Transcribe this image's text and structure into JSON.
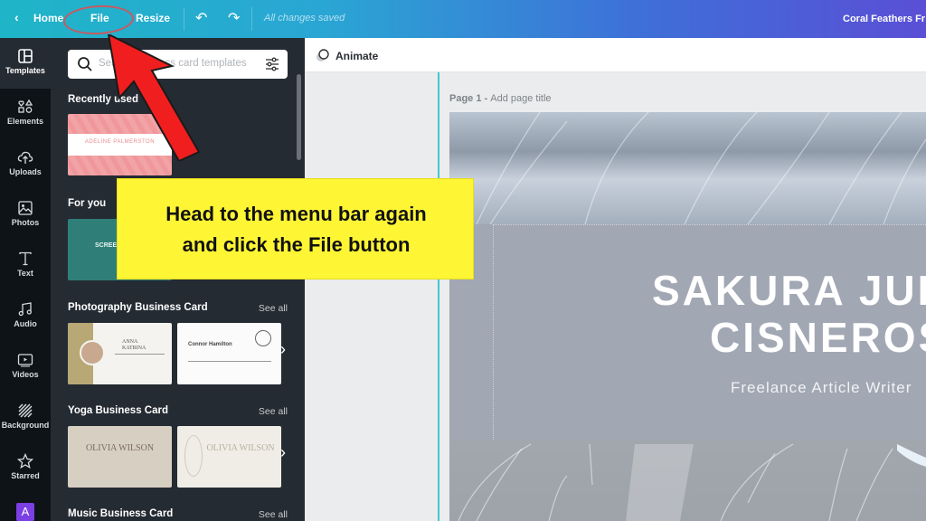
{
  "topbar": {
    "back_icon": "chevron-left-icon",
    "home": "Home",
    "file": "File",
    "resize": "Resize",
    "undo_icon": "undo-icon",
    "redo_icon": "redo-icon",
    "save_status": "All changes saved",
    "doc_title": "Coral Feathers Fr"
  },
  "rail": {
    "items": [
      {
        "label": "Templates",
        "icon": "templates-icon",
        "active": true
      },
      {
        "label": "Elements",
        "icon": "elements-icon"
      },
      {
        "label": "Uploads",
        "icon": "upload-cloud-icon"
      },
      {
        "label": "Photos",
        "icon": "photo-icon"
      },
      {
        "label": "Text",
        "icon": "text-icon"
      },
      {
        "label": "Audio",
        "icon": "music-note-icon"
      },
      {
        "label": "Videos",
        "icon": "video-icon"
      },
      {
        "label": "Background",
        "icon": "background-hatch-icon"
      },
      {
        "label": "Starred",
        "icon": "star-icon"
      }
    ],
    "app_tile": "A"
  },
  "panel": {
    "search_placeholder": "Search business card templates",
    "search_visible_start": "Sea",
    "search_visible_end": "ss card templates",
    "sections": [
      {
        "title": "Recently used",
        "cards": [
          {
            "text": "ADELINE PALMERSTON",
            "color": "#f2a3a6"
          }
        ]
      },
      {
        "title": "For you",
        "cards": [
          {
            "text": "SCREE FILM",
            "color": "#2f7f78"
          }
        ]
      },
      {
        "title": "Photography Business Card",
        "see_all": "See all",
        "cards": [
          {
            "text": "ANNA KATRINA"
          },
          {
            "text": "Connor Hamilton"
          }
        ]
      },
      {
        "title": "Yoga Business Card",
        "see_all": "See all",
        "cards": [
          {
            "text": "OLIVIA WILSON"
          },
          {
            "text": "OLIVIA WILSON"
          }
        ]
      },
      {
        "title": "Music Business Card",
        "see_all": "See all"
      }
    ]
  },
  "toolbar": {
    "animate": "Animate"
  },
  "page": {
    "label_prefix": "Page 1 - ",
    "label_title": "Add page title",
    "design": {
      "name_line1": "SAKURA JUL",
      "name_line2": "CISNEROS",
      "role": "Freelance Article Writer"
    }
  },
  "annotation": {
    "callout_line1": "Head to the menu bar again",
    "callout_line2": "and click the File button",
    "callout_color": "#fef535",
    "arrow_color": "#f01e1e",
    "circle_color": "#c65a62"
  },
  "colors": {
    "topbar_start": "#1fb5c8",
    "topbar_end": "#5a4fd6",
    "rail_bg": "#0e1318",
    "panel_bg": "#252b33",
    "guide": "#45c6cf"
  }
}
